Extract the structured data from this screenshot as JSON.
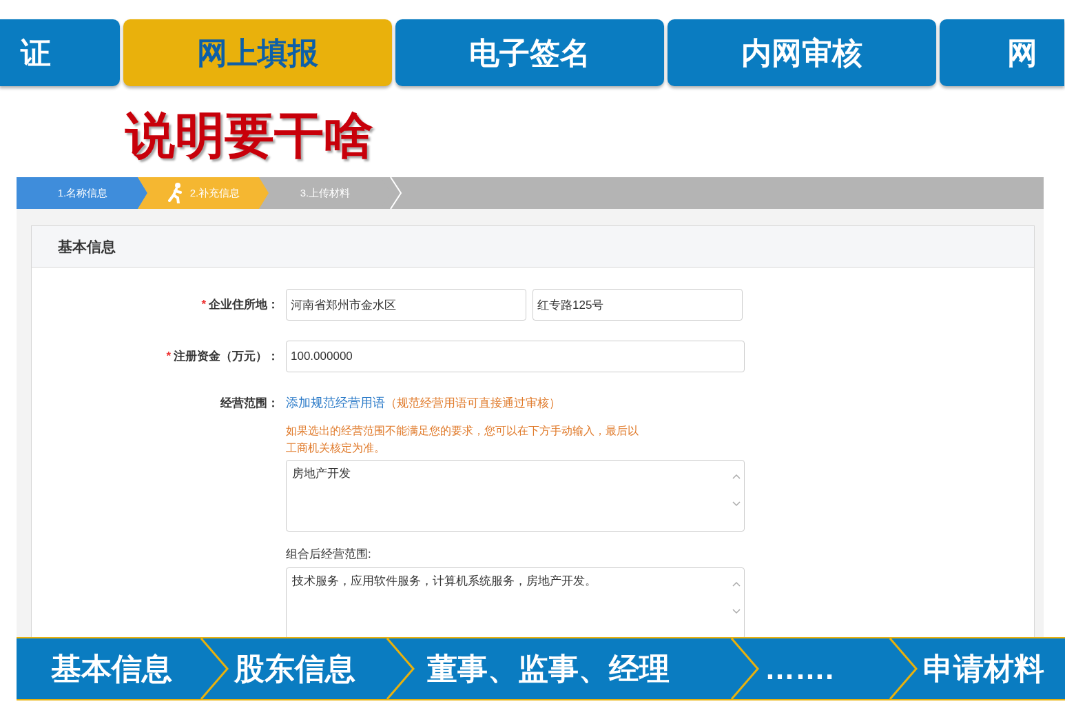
{
  "tabs": [
    {
      "label": "证",
      "selected": false
    },
    {
      "label": "网上填报",
      "selected": true
    },
    {
      "label": "电子签名",
      "selected": false
    },
    {
      "label": "内网审核",
      "selected": false
    },
    {
      "label": "网",
      "selected": false
    }
  ],
  "heading": "说明要干啥",
  "steps": [
    {
      "label": "1.名称信息",
      "kind": "done"
    },
    {
      "label": "2.补充信息",
      "kind": "current"
    },
    {
      "label": "3.上传材料",
      "kind": "pending"
    }
  ],
  "section_title": "基本信息",
  "address": {
    "label": "企业住所地：",
    "required_mark": "*",
    "value_1": "河南省郑州市金水区",
    "value_2": "红专路125号"
  },
  "capital": {
    "label": "注册资金（万元）：",
    "required_mark": "*",
    "value": "100.000000"
  },
  "scope": {
    "label": "经营范围：",
    "link": "添加规范经营用语",
    "note": "（规范经营用语可直接通过审核）",
    "hint": "如果选出的经营范围不能满足您的要求，您可以在下方手动输入，最后以工商机关核定为准。",
    "value": "房地产开发",
    "combined_label": "组合后经营范围:",
    "combined_value": "技术服务，应用软件服务，计算机系统服务，房地产开发。"
  },
  "flow": [
    "基本信息",
    "股东信息",
    "董事、监事、经理",
    "…….",
    "申请材料"
  ]
}
